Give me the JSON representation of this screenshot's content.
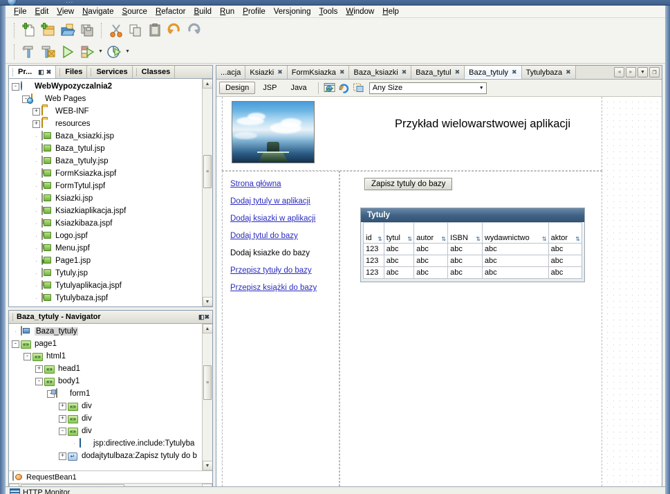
{
  "window": {
    "orb": "netbeans-orb",
    "ghost_title": "..."
  },
  "menubar": {
    "items": [
      {
        "label": "File",
        "mn": "F"
      },
      {
        "label": "Edit",
        "mn": "E"
      },
      {
        "label": "View",
        "mn": "V"
      },
      {
        "label": "Navigate",
        "mn": "N"
      },
      {
        "label": "Source",
        "mn": "S"
      },
      {
        "label": "Refactor",
        "mn": "R"
      },
      {
        "label": "Build",
        "mn": "B"
      },
      {
        "label": "Run",
        "mn": "R"
      },
      {
        "label": "Profile",
        "mn": "P"
      },
      {
        "label": "Versioning",
        "mn": "i"
      },
      {
        "label": "Tools",
        "mn": "T"
      },
      {
        "label": "Window",
        "mn": "W"
      },
      {
        "label": "Help",
        "mn": "H"
      }
    ]
  },
  "toolbar": {
    "row1": [
      {
        "name": "new-file-icon",
        "title": "New File"
      },
      {
        "name": "new-project-icon",
        "title": "New Project"
      },
      {
        "name": "open-project-icon",
        "title": "Open Project"
      },
      {
        "name": "save-all-icon",
        "title": "Save All"
      },
      {
        "name": "cut-icon",
        "title": "Cut"
      },
      {
        "name": "copy-icon",
        "title": "Copy"
      },
      {
        "name": "paste-icon",
        "title": "Paste"
      },
      {
        "name": "undo-icon",
        "title": "Undo"
      },
      {
        "name": "redo-icon",
        "title": "Redo"
      }
    ],
    "row2": [
      {
        "name": "build-icon",
        "title": "Build Main Project"
      },
      {
        "name": "clean-build-icon",
        "title": "Clean and Build"
      },
      {
        "name": "run-icon",
        "title": "Run Main Project"
      },
      {
        "name": "debug-icon",
        "title": "Debug Main Project"
      },
      {
        "name": "profile-icon",
        "title": "Profile Main Project"
      }
    ]
  },
  "left_panel": {
    "tabs": [
      {
        "label": "Pr...",
        "active": true
      },
      {
        "label": "Files",
        "active": false
      },
      {
        "label": "Services",
        "active": false
      },
      {
        "label": "Classes",
        "active": false
      }
    ],
    "tab_buttons": {
      "minimize": "◧",
      "close": "✖"
    },
    "tree": [
      {
        "depth": 0,
        "exp": "-",
        "icon": "globe",
        "label": "WebWypozyczalnia2",
        "bold": true
      },
      {
        "depth": 1,
        "exp": "-",
        "icon": "webpages",
        "label": "Web Pages",
        "bold": false
      },
      {
        "depth": 2,
        "exp": "+",
        "icon": "folder",
        "label": "WEB-INF",
        "bold": false
      },
      {
        "depth": 2,
        "exp": "+",
        "icon": "folder",
        "label": "resources",
        "bold": false
      },
      {
        "depth": 2,
        "exp": "",
        "icon": "jsp",
        "label": "Baza_ksiazki.jsp",
        "bold": false
      },
      {
        "depth": 2,
        "exp": "",
        "icon": "jsp",
        "label": "Baza_tytul.jsp",
        "bold": false
      },
      {
        "depth": 2,
        "exp": "",
        "icon": "jsp",
        "label": "Baza_tytuly.jsp",
        "bold": false
      },
      {
        "depth": 2,
        "exp": "",
        "icon": "jspf",
        "label": "FormKsiazka.jspf",
        "bold": false
      },
      {
        "depth": 2,
        "exp": "",
        "icon": "jspf",
        "label": "FormTytul.jspf",
        "bold": false
      },
      {
        "depth": 2,
        "exp": "",
        "icon": "jsp",
        "label": "Ksiazki.jsp",
        "bold": false
      },
      {
        "depth": 2,
        "exp": "",
        "icon": "jspf",
        "label": "Ksiazkiaplikacja.jspf",
        "bold": false
      },
      {
        "depth": 2,
        "exp": "",
        "icon": "jspf",
        "label": "Ksiazkibaza.jspf",
        "bold": false
      },
      {
        "depth": 2,
        "exp": "",
        "icon": "jspf",
        "label": "Logo.jspf",
        "bold": false
      },
      {
        "depth": 2,
        "exp": "",
        "icon": "jspf",
        "label": "Menu.jspf",
        "bold": false
      },
      {
        "depth": 2,
        "exp": "",
        "icon": "jsp-main",
        "label": "Page1.jsp",
        "bold": false
      },
      {
        "depth": 2,
        "exp": "",
        "icon": "jsp",
        "label": "Tytuly.jsp",
        "bold": false
      },
      {
        "depth": 2,
        "exp": "",
        "icon": "jspf",
        "label": "Tytulyaplikacja.jspf",
        "bold": false
      },
      {
        "depth": 2,
        "exp": "",
        "icon": "jspf",
        "label": "Tytulybaza.jspf",
        "bold": false
      }
    ]
  },
  "navigator": {
    "title": "Baza_tytuly - Navigator",
    "buttons": {
      "minimize": "◧",
      "close": "✖"
    },
    "tree": [
      {
        "depth": 0,
        "exp": "",
        "icon": "page",
        "label": "Baza_tytuly",
        "sel": true
      },
      {
        "depth": 0,
        "exp": "-",
        "icon": "chev",
        "label": "page1",
        "sel": false
      },
      {
        "depth": 1,
        "exp": "-",
        "icon": "chev",
        "label": "html1",
        "sel": false
      },
      {
        "depth": 2,
        "exp": "+",
        "icon": "chev",
        "label": "head1",
        "sel": false
      },
      {
        "depth": 2,
        "exp": "-",
        "icon": "chev",
        "label": "body1",
        "sel": false
      },
      {
        "depth": 3,
        "exp": "-",
        "icon": "form",
        "label": "form1",
        "sel": false
      },
      {
        "depth": 4,
        "exp": "+",
        "icon": "chev",
        "label": "div",
        "sel": false
      },
      {
        "depth": 4,
        "exp": "+",
        "icon": "chev",
        "label": "div",
        "sel": false
      },
      {
        "depth": 4,
        "exp": "-",
        "icon": "chev",
        "label": "div",
        "sel": false
      },
      {
        "depth": 5,
        "exp": "",
        "icon": "include",
        "label": "jsp:directive.include:Tytulyba",
        "sel": false
      },
      {
        "depth": 4,
        "exp": "+",
        "icon": "button",
        "label": "dodajtytulbaza:Zapisz tytuly do b",
        "sel": false
      }
    ],
    "footer_item": {
      "icon": "bean",
      "label": "RequestBean1"
    }
  },
  "editor": {
    "tabs": [
      {
        "label": "...acja",
        "closable": false,
        "active": false
      },
      {
        "label": "Ksiazki",
        "closable": true,
        "active": false
      },
      {
        "label": "FormKsiazka",
        "closable": true,
        "active": false
      },
      {
        "label": "Baza_ksiazki",
        "closable": true,
        "active": false
      },
      {
        "label": "Baza_tytul",
        "closable": true,
        "active": false
      },
      {
        "label": "Baza_tytuly",
        "closable": true,
        "active": true
      },
      {
        "label": "Tytulybaza",
        "closable": true,
        "active": false
      }
    ],
    "close_glyph": "✖",
    "nav_buttons": [
      {
        "name": "tab-scroll-left-button",
        "glyph": "◄",
        "disabled": true
      },
      {
        "name": "tab-scroll-right-button",
        "glyph": "►",
        "disabled": true
      },
      {
        "name": "tab-list-button",
        "glyph": "▼",
        "disabled": false
      },
      {
        "name": "maximize-editor-button",
        "glyph": "❐",
        "disabled": false
      }
    ],
    "view_buttons": [
      {
        "label": "Design",
        "selected": true
      },
      {
        "label": "JSP",
        "selected": false
      },
      {
        "label": "Java",
        "selected": false
      }
    ],
    "design_icons": [
      {
        "name": "preview-in-browser-icon"
      },
      {
        "name": "refresh-icon"
      },
      {
        "name": "show-virtual-forms-icon"
      }
    ],
    "size_select": {
      "value": "Any Size",
      "caret": "▼"
    }
  },
  "design": {
    "title": "Przykład wielowarstwowej aplikacji",
    "save_button": "Zapisz tytuly do bazy",
    "links": [
      {
        "text": "Strona główna",
        "is_link": true
      },
      {
        "text": "Dodaj tytuly w aplikacji",
        "is_link": true
      },
      {
        "text": "Dodaj ksiazki w aplikacji",
        "is_link": true
      },
      {
        "text": "Dodaj tytul do bazy",
        "is_link": true
      },
      {
        "text": "Dodaj ksiazke do bazy",
        "is_link": false
      },
      {
        "text": "Przepisz tytuły do bazy",
        "is_link": true
      },
      {
        "text": "Przepisz książki do bazy",
        "is_link": true
      }
    ],
    "table": {
      "caption": "Tytuly",
      "sort_glyph": "⇅",
      "columns": [
        "id",
        "tytul",
        "autor",
        "ISBN",
        "wydawnictwo",
        "aktor"
      ],
      "rows": [
        [
          "123",
          "abc",
          "abc",
          "abc",
          "abc",
          "abc"
        ],
        [
          "123",
          "abc",
          "abc",
          "abc",
          "abc",
          "abc"
        ],
        [
          "123",
          "abc",
          "abc",
          "abc",
          "abc",
          "abc"
        ]
      ]
    }
  },
  "palette_sliver": {
    "label": "HTTP Monitor"
  },
  "colors": {
    "link": "#2a2ac0",
    "table_header": "#3f6285",
    "accent": "#4c6d99"
  }
}
